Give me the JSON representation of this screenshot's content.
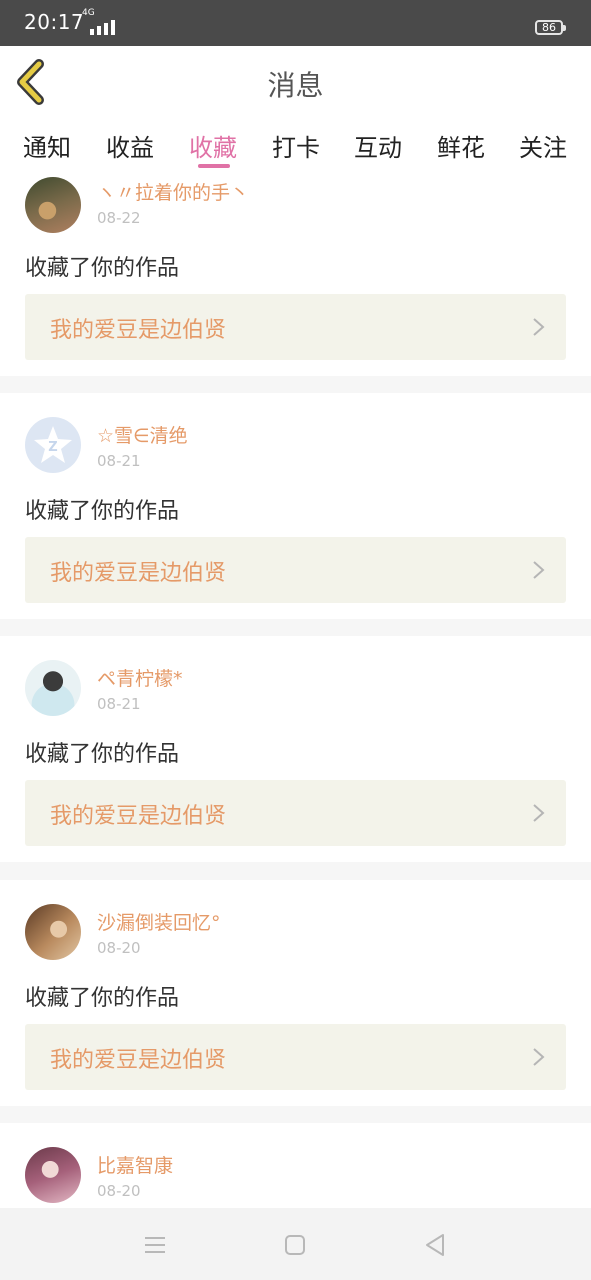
{
  "status_bar": {
    "time": "20:17",
    "network": "4G",
    "battery": "86"
  },
  "header": {
    "title": "消息",
    "back_icon": "back-chevron-icon",
    "back_color": "#e6cc44"
  },
  "tabs": [
    {
      "label": "通知",
      "active": false
    },
    {
      "label": "收益",
      "active": false
    },
    {
      "label": "收藏",
      "active": true
    },
    {
      "label": "打卡",
      "active": false
    },
    {
      "label": "互动",
      "active": false
    },
    {
      "label": "鲜花",
      "active": false
    },
    {
      "label": "关注",
      "active": false
    }
  ],
  "accent_color": "#e072a6",
  "username_color": "#e59a68",
  "messages": [
    {
      "username": "ヽ〃拉着你的手丶",
      "date": "08-22",
      "action": "收藏了你的作品",
      "work_title": "我的爱豆是边伯贤"
    },
    {
      "username": "☆雪∈清绝",
      "date": "08-21",
      "action": "收藏了你的作品",
      "work_title": "我的爱豆是边伯贤"
    },
    {
      "username": "ペ青柠檬*",
      "date": "08-21",
      "action": "收藏了你的作品",
      "work_title": "我的爱豆是边伯贤"
    },
    {
      "username": "沙漏倒装回忆°",
      "date": "08-20",
      "action": "收藏了你的作品",
      "work_title": "我的爱豆是边伯贤"
    },
    {
      "username": "比嘉智康",
      "date": "08-20"
    }
  ]
}
